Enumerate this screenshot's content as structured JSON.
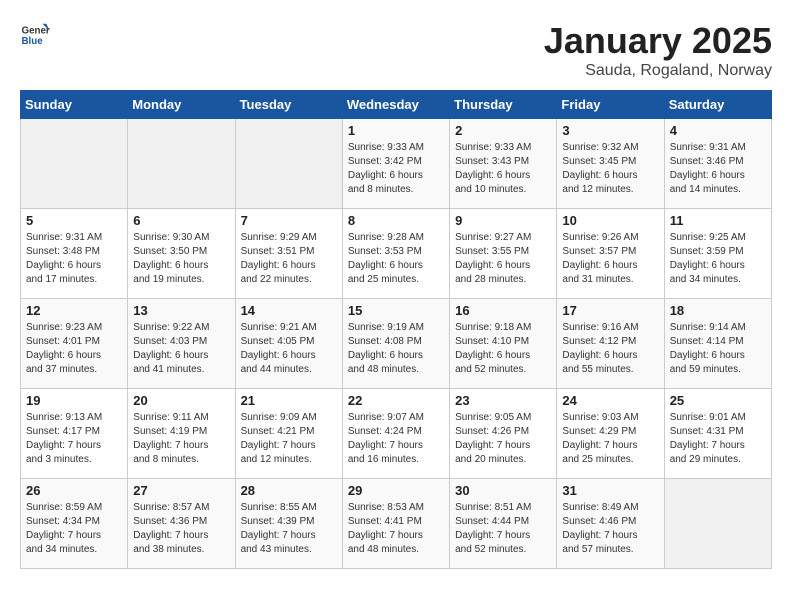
{
  "header": {
    "logo_general": "General",
    "logo_blue": "Blue",
    "title": "January 2025",
    "subtitle": "Sauda, Rogaland, Norway"
  },
  "days_of_week": [
    "Sunday",
    "Monday",
    "Tuesday",
    "Wednesday",
    "Thursday",
    "Friday",
    "Saturday"
  ],
  "weeks": [
    [
      {
        "day": "",
        "info": ""
      },
      {
        "day": "",
        "info": ""
      },
      {
        "day": "",
        "info": ""
      },
      {
        "day": "1",
        "info": "Sunrise: 9:33 AM\nSunset: 3:42 PM\nDaylight: 6 hours\nand 8 minutes."
      },
      {
        "day": "2",
        "info": "Sunrise: 9:33 AM\nSunset: 3:43 PM\nDaylight: 6 hours\nand 10 minutes."
      },
      {
        "day": "3",
        "info": "Sunrise: 9:32 AM\nSunset: 3:45 PM\nDaylight: 6 hours\nand 12 minutes."
      },
      {
        "day": "4",
        "info": "Sunrise: 9:31 AM\nSunset: 3:46 PM\nDaylight: 6 hours\nand 14 minutes."
      }
    ],
    [
      {
        "day": "5",
        "info": "Sunrise: 9:31 AM\nSunset: 3:48 PM\nDaylight: 6 hours\nand 17 minutes."
      },
      {
        "day": "6",
        "info": "Sunrise: 9:30 AM\nSunset: 3:50 PM\nDaylight: 6 hours\nand 19 minutes."
      },
      {
        "day": "7",
        "info": "Sunrise: 9:29 AM\nSunset: 3:51 PM\nDaylight: 6 hours\nand 22 minutes."
      },
      {
        "day": "8",
        "info": "Sunrise: 9:28 AM\nSunset: 3:53 PM\nDaylight: 6 hours\nand 25 minutes."
      },
      {
        "day": "9",
        "info": "Sunrise: 9:27 AM\nSunset: 3:55 PM\nDaylight: 6 hours\nand 28 minutes."
      },
      {
        "day": "10",
        "info": "Sunrise: 9:26 AM\nSunset: 3:57 PM\nDaylight: 6 hours\nand 31 minutes."
      },
      {
        "day": "11",
        "info": "Sunrise: 9:25 AM\nSunset: 3:59 PM\nDaylight: 6 hours\nand 34 minutes."
      }
    ],
    [
      {
        "day": "12",
        "info": "Sunrise: 9:23 AM\nSunset: 4:01 PM\nDaylight: 6 hours\nand 37 minutes."
      },
      {
        "day": "13",
        "info": "Sunrise: 9:22 AM\nSunset: 4:03 PM\nDaylight: 6 hours\nand 41 minutes."
      },
      {
        "day": "14",
        "info": "Sunrise: 9:21 AM\nSunset: 4:05 PM\nDaylight: 6 hours\nand 44 minutes."
      },
      {
        "day": "15",
        "info": "Sunrise: 9:19 AM\nSunset: 4:08 PM\nDaylight: 6 hours\nand 48 minutes."
      },
      {
        "day": "16",
        "info": "Sunrise: 9:18 AM\nSunset: 4:10 PM\nDaylight: 6 hours\nand 52 minutes."
      },
      {
        "day": "17",
        "info": "Sunrise: 9:16 AM\nSunset: 4:12 PM\nDaylight: 6 hours\nand 55 minutes."
      },
      {
        "day": "18",
        "info": "Sunrise: 9:14 AM\nSunset: 4:14 PM\nDaylight: 6 hours\nand 59 minutes."
      }
    ],
    [
      {
        "day": "19",
        "info": "Sunrise: 9:13 AM\nSunset: 4:17 PM\nDaylight: 7 hours\nand 3 minutes."
      },
      {
        "day": "20",
        "info": "Sunrise: 9:11 AM\nSunset: 4:19 PM\nDaylight: 7 hours\nand 8 minutes."
      },
      {
        "day": "21",
        "info": "Sunrise: 9:09 AM\nSunset: 4:21 PM\nDaylight: 7 hours\nand 12 minutes."
      },
      {
        "day": "22",
        "info": "Sunrise: 9:07 AM\nSunset: 4:24 PM\nDaylight: 7 hours\nand 16 minutes."
      },
      {
        "day": "23",
        "info": "Sunrise: 9:05 AM\nSunset: 4:26 PM\nDaylight: 7 hours\nand 20 minutes."
      },
      {
        "day": "24",
        "info": "Sunrise: 9:03 AM\nSunset: 4:29 PM\nDaylight: 7 hours\nand 25 minutes."
      },
      {
        "day": "25",
        "info": "Sunrise: 9:01 AM\nSunset: 4:31 PM\nDaylight: 7 hours\nand 29 minutes."
      }
    ],
    [
      {
        "day": "26",
        "info": "Sunrise: 8:59 AM\nSunset: 4:34 PM\nDaylight: 7 hours\nand 34 minutes."
      },
      {
        "day": "27",
        "info": "Sunrise: 8:57 AM\nSunset: 4:36 PM\nDaylight: 7 hours\nand 38 minutes."
      },
      {
        "day": "28",
        "info": "Sunrise: 8:55 AM\nSunset: 4:39 PM\nDaylight: 7 hours\nand 43 minutes."
      },
      {
        "day": "29",
        "info": "Sunrise: 8:53 AM\nSunset: 4:41 PM\nDaylight: 7 hours\nand 48 minutes."
      },
      {
        "day": "30",
        "info": "Sunrise: 8:51 AM\nSunset: 4:44 PM\nDaylight: 7 hours\nand 52 minutes."
      },
      {
        "day": "31",
        "info": "Sunrise: 8:49 AM\nSunset: 4:46 PM\nDaylight: 7 hours\nand 57 minutes."
      },
      {
        "day": "",
        "info": ""
      }
    ]
  ]
}
